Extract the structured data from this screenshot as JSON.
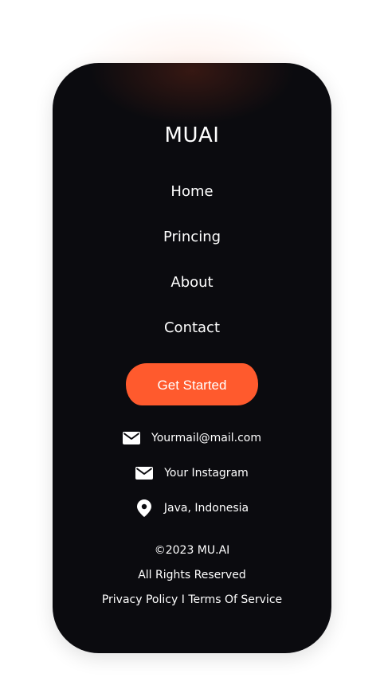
{
  "brand": "MUAI",
  "nav": {
    "home": "Home",
    "pricing": "Princing",
    "about": "About",
    "contact": "Contact"
  },
  "cta": {
    "label": "Get Started",
    "color": "#ff5a2d"
  },
  "contacts": {
    "email": {
      "icon": "mail-icon",
      "text": "Yourmail@mail.com"
    },
    "instagram": {
      "icon": "mail-icon",
      "text": "Your Instagram"
    },
    "location": {
      "icon": "location-pin-icon",
      "text": "Java, Indonesia"
    }
  },
  "footer": {
    "copyright": "©2023 MU.AI",
    "rights": "All Rights Reserved",
    "privacy": "Privacy Policy",
    "separator": "I",
    "terms": "Terms Of Service"
  },
  "colors": {
    "background": "#0b0b0f",
    "accent": "#ff5a2d",
    "text": "#ffffff"
  }
}
